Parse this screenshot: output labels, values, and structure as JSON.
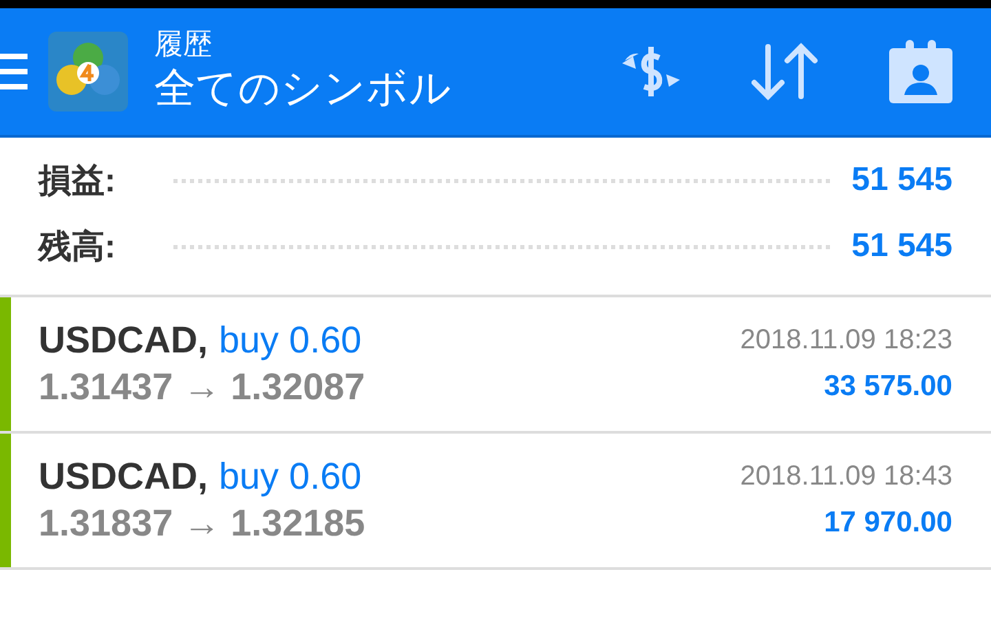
{
  "header": {
    "title": "履歴",
    "subtitle": "全てのシンボル"
  },
  "summary": [
    {
      "label": "損益:",
      "value": "51 545"
    },
    {
      "label": "残高:",
      "value": "51 545"
    }
  ],
  "trades": [
    {
      "symbol": "USDCAD,",
      "order": "buy 0.60",
      "prices": "1.31437 → 1.32087",
      "time": "2018.11.09 18:23",
      "profit": "33 575.00"
    },
    {
      "symbol": "USDCAD,",
      "order": "buy 0.60",
      "prices": "1.31837 → 1.32185",
      "time": "2018.11.09 18:43",
      "profit": "17 970.00"
    }
  ]
}
